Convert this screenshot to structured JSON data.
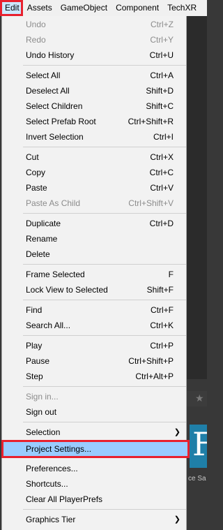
{
  "menubar": {
    "items": [
      "Edit",
      "Assets",
      "GameObject",
      "Component",
      "TechXR"
    ],
    "active_index": 0
  },
  "background": {
    "star_icon": "star-icon",
    "logo_glyph": "F",
    "caption": "ce Sa"
  },
  "menu": {
    "items": [
      {
        "label": "Undo",
        "shortcut": "Ctrl+Z",
        "enabled": false
      },
      {
        "label": "Redo",
        "shortcut": "Ctrl+Y",
        "enabled": false
      },
      {
        "label": "Undo History",
        "shortcut": "Ctrl+U",
        "enabled": true
      },
      {
        "label": "Select All",
        "shortcut": "Ctrl+A",
        "enabled": true
      },
      {
        "label": "Deselect All",
        "shortcut": "Shift+D",
        "enabled": true
      },
      {
        "label": "Select Children",
        "shortcut": "Shift+C",
        "enabled": true
      },
      {
        "label": "Select Prefab Root",
        "shortcut": "Ctrl+Shift+R",
        "enabled": true
      },
      {
        "label": "Invert Selection",
        "shortcut": "Ctrl+I",
        "enabled": true
      },
      {
        "label": "Cut",
        "shortcut": "Ctrl+X",
        "enabled": true
      },
      {
        "label": "Copy",
        "shortcut": "Ctrl+C",
        "enabled": true
      },
      {
        "label": "Paste",
        "shortcut": "Ctrl+V",
        "enabled": true
      },
      {
        "label": "Paste As Child",
        "shortcut": "Ctrl+Shift+V",
        "enabled": false
      },
      {
        "label": "Duplicate",
        "shortcut": "Ctrl+D",
        "enabled": true
      },
      {
        "label": "Rename",
        "shortcut": "",
        "enabled": true
      },
      {
        "label": "Delete",
        "shortcut": "",
        "enabled": true
      },
      {
        "label": "Frame Selected",
        "shortcut": "F",
        "enabled": true
      },
      {
        "label": "Lock View to Selected",
        "shortcut": "Shift+F",
        "enabled": true
      },
      {
        "label": "Find",
        "shortcut": "Ctrl+F",
        "enabled": true
      },
      {
        "label": "Search All...",
        "shortcut": "Ctrl+K",
        "enabled": true
      },
      {
        "label": "Play",
        "shortcut": "Ctrl+P",
        "enabled": true
      },
      {
        "label": "Pause",
        "shortcut": "Ctrl+Shift+P",
        "enabled": true
      },
      {
        "label": "Step",
        "shortcut": "Ctrl+Alt+P",
        "enabled": true
      },
      {
        "label": "Sign in...",
        "shortcut": "",
        "enabled": false
      },
      {
        "label": "Sign out",
        "shortcut": "",
        "enabled": true
      },
      {
        "label": "Selection",
        "shortcut": "",
        "enabled": true,
        "submenu": true
      },
      {
        "label": "Project Settings...",
        "shortcut": "",
        "enabled": true,
        "highlighted": true
      },
      {
        "label": "Preferences...",
        "shortcut": "",
        "enabled": true
      },
      {
        "label": "Shortcuts...",
        "shortcut": "",
        "enabled": true
      },
      {
        "label": "Clear All PlayerPrefs",
        "shortcut": "",
        "enabled": true
      },
      {
        "label": "Graphics Tier",
        "shortcut": "",
        "enabled": true,
        "submenu": true
      }
    ],
    "submenu_arrow": "chevron-right-icon"
  },
  "colors": {
    "highlight_fill": "#99ccff",
    "annotation_red": "#e8212e",
    "disabled_text": "#8c8c8c",
    "menu_bg": "#f2f2f2"
  }
}
